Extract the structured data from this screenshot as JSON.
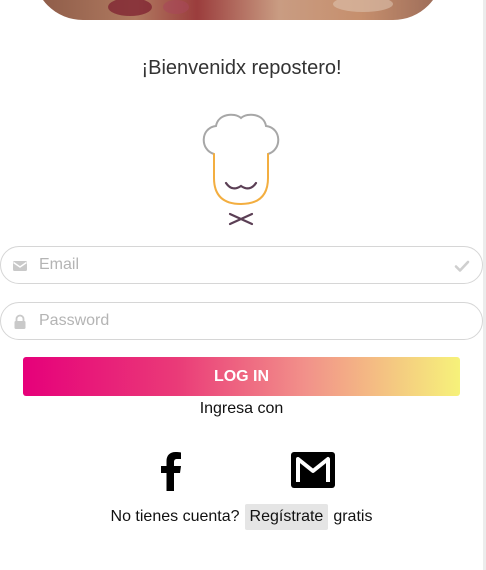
{
  "welcome_text": "¡Bienvenidx repostero!",
  "email": {
    "placeholder": "Email",
    "value": ""
  },
  "password": {
    "placeholder": "Password",
    "value": ""
  },
  "login_button": "LOG IN",
  "social_prompt": "Ingresa con",
  "register": {
    "prompt": "No tienes cuenta?",
    "link": "Regístrate",
    "suffix": "gratis"
  },
  "colors": {
    "gradient_start": "#e6007a",
    "gradient_mid": "#f2928a",
    "gradient_end": "#f6f27a"
  },
  "icons": [
    "envelope-icon",
    "check-icon",
    "lock-icon",
    "facebook-icon",
    "gmail-icon",
    "chef-logo"
  ]
}
